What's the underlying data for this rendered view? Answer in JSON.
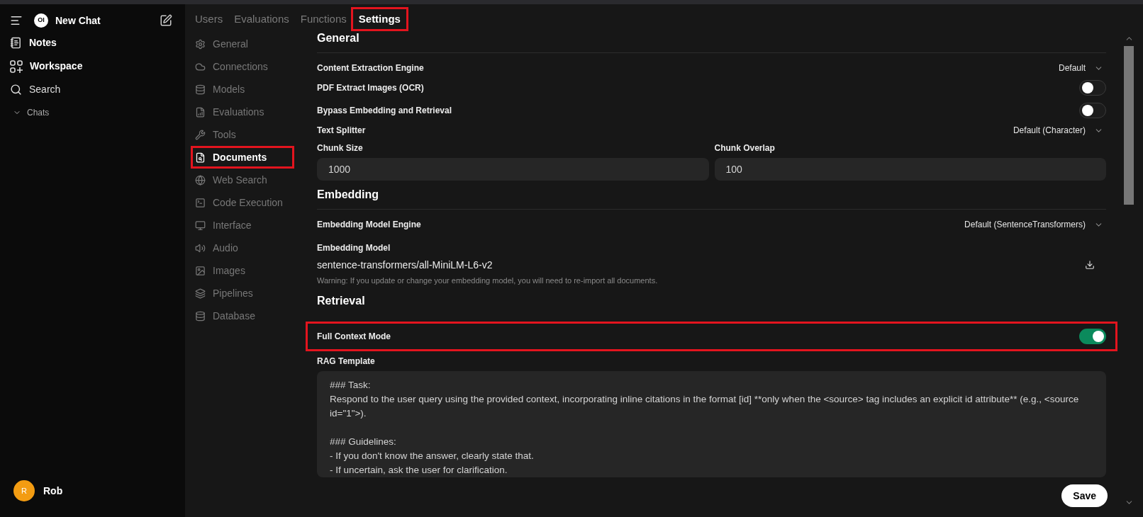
{
  "sidebar": {
    "logo": "OI",
    "title": "New Chat",
    "items": [
      {
        "label": "Notes"
      },
      {
        "label": "Workspace"
      },
      {
        "label": "Search"
      }
    ],
    "section": "Chats",
    "user": {
      "initial": "R",
      "name": "Rob"
    }
  },
  "tabs": [
    {
      "label": "Users",
      "selected": false,
      "highlighted": false
    },
    {
      "label": "Evaluations",
      "selected": false,
      "highlighted": false
    },
    {
      "label": "Functions",
      "selected": false,
      "highlighted": false
    },
    {
      "label": "Settings",
      "selected": true,
      "highlighted": true
    }
  ],
  "nav": [
    {
      "label": "General",
      "selected": false,
      "highlighted": false
    },
    {
      "label": "Connections",
      "selected": false,
      "highlighted": false
    },
    {
      "label": "Models",
      "selected": false,
      "highlighted": false
    },
    {
      "label": "Evaluations",
      "selected": false,
      "highlighted": false
    },
    {
      "label": "Tools",
      "selected": false,
      "highlighted": false
    },
    {
      "label": "Documents",
      "selected": true,
      "highlighted": true
    },
    {
      "label": "Web Search",
      "selected": false,
      "highlighted": false
    },
    {
      "label": "Code Execution",
      "selected": false,
      "highlighted": false
    },
    {
      "label": "Interface",
      "selected": false,
      "highlighted": false
    },
    {
      "label": "Audio",
      "selected": false,
      "highlighted": false
    },
    {
      "label": "Images",
      "selected": false,
      "highlighted": false
    },
    {
      "label": "Pipelines",
      "selected": false,
      "highlighted": false
    },
    {
      "label": "Database",
      "selected": false,
      "highlighted": false
    }
  ],
  "sections": [
    {
      "title": "General",
      "divider": true,
      "rows": [
        {
          "kind": "select",
          "label": "Content Extraction Engine",
          "value": "Default"
        },
        {
          "kind": "toggle",
          "label": "PDF Extract Images (OCR)",
          "on": false,
          "highlighted": false
        },
        {
          "kind": "toggle",
          "label": "Bypass Embedding and Retrieval",
          "on": false,
          "highlighted": false
        },
        {
          "kind": "select",
          "label": "Text Splitter",
          "value": "Default (Character)"
        },
        {
          "kind": "inputs",
          "fields": [
            {
              "label": "Chunk Size",
              "value": "1000"
            },
            {
              "label": "Chunk Overlap",
              "value": "100"
            }
          ]
        }
      ]
    },
    {
      "title": "Embedding",
      "divider": true,
      "rows": [
        {
          "kind": "select",
          "label": "Embedding Model Engine",
          "value": "Default (SentenceTransformers)"
        },
        {
          "kind": "model",
          "label": "Embedding Model",
          "value": "sentence-transformers/all-MiniLM-L6-v2",
          "note": "Warning: If you update or change your embedding model, you will need to re-import all documents."
        }
      ]
    },
    {
      "title": "Retrieval",
      "divider": false,
      "rows": [
        {
          "kind": "toggle",
          "label": "Full Context Mode",
          "on": true,
          "highlighted": true
        },
        {
          "kind": "textarea",
          "label": "RAG Template",
          "value": "### Task:\nRespond to the user query using the provided context, incorporating inline citations in the format [id] **only when the <source> tag includes an explicit id attribute** (e.g., <source id=\"1\">).\n\n### Guidelines:\n- If you don't know the answer, clearly state that.\n- If uncertain, ask the user for clarification."
        }
      ]
    }
  ],
  "save": "Save"
}
